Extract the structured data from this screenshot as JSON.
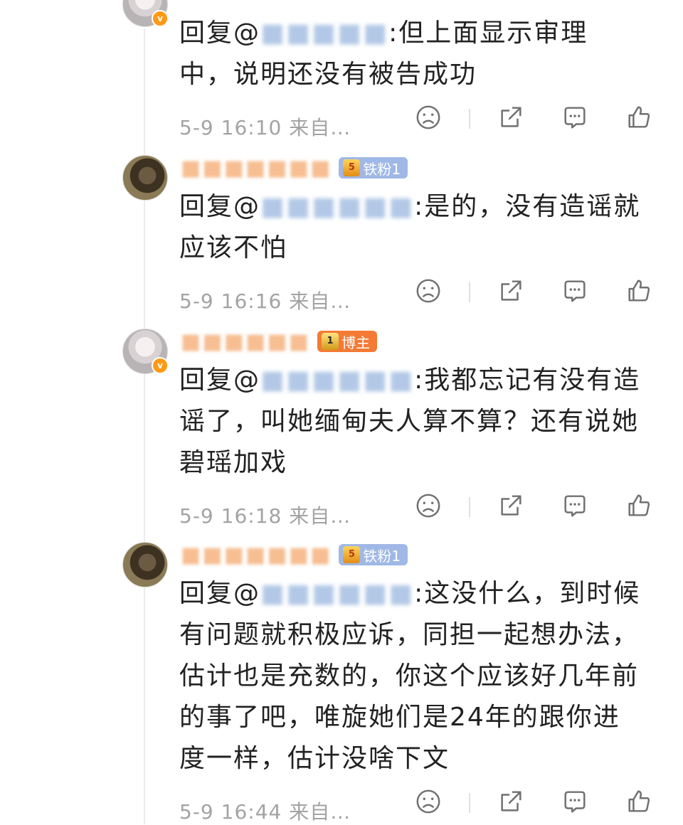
{
  "comments": [
    {
      "name": "",
      "badge": "",
      "reply_prefix": "回复@",
      "mention": "",
      "text": ":但上面显示审理中，说明还没有被告成功",
      "time": "5-9 16:10",
      "from": "来自…"
    },
    {
      "name": "",
      "badge": "铁粉1",
      "reply_prefix": "回复@",
      "mention": "",
      "text": ":是的，没有造谣就应该不怕",
      "time": "5-9 16:16",
      "from": "来自…"
    },
    {
      "name": "",
      "badge": "博主",
      "reply_prefix": "回复@",
      "mention": "",
      "text": ":我都忘记有没有造谣了，叫她缅甸夫人算不算？还有说她碧瑶加戏",
      "time": "5-9 16:18",
      "from": "来自…"
    },
    {
      "name": "",
      "badge": "铁粉1",
      "reply_prefix": "回复@",
      "mention": "",
      "text": ":这没什么，到时候有问题就积极应诉，同担一起想办法，估计也是充数的，你这个应该好几年前的事了吧，唯旋她们是24年的跟你进度一样，估计没啥下文",
      "time": "5-9 16:44",
      "from": "来自…"
    }
  ],
  "icons": {
    "dislike": "sad-face-icon",
    "share": "share-icon",
    "comment": "comment-icon",
    "like": "thumbs-up-icon"
  },
  "colors": {
    "mention": "#4e7fbe",
    "meta": "#a3a3a3",
    "badge_fans": "#9fb8e6",
    "badge_owner": "#f47a35"
  }
}
